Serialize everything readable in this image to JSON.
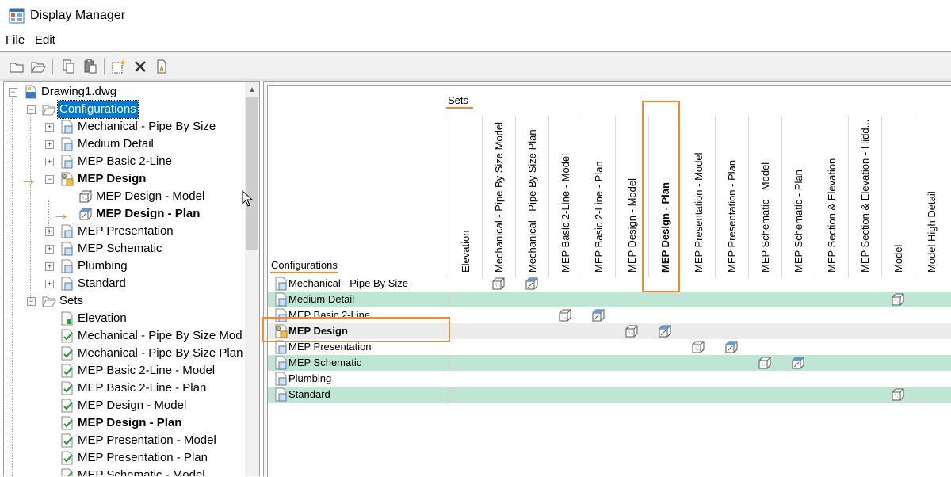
{
  "window": {
    "title": "Display Manager"
  },
  "menu": {
    "items": [
      "File",
      "Edit"
    ]
  },
  "toolbar": {
    "buttons": [
      "new-icon",
      "open-icon",
      "copy-icon",
      "paste-icon",
      "new-set-icon",
      "delete-icon",
      "properties-icon"
    ]
  },
  "tree": {
    "root": "Drawing1.dwg",
    "configurations_label": "Configurations",
    "configurations": [
      "Mechanical - Pipe By Size",
      "Medium Detail",
      "MEP Basic 2-Line",
      "MEP Design",
      "MEP Presentation",
      "MEP Schematic",
      "Plumbing",
      "Standard"
    ],
    "mep_design_children": [
      "MEP Design - Model",
      "MEP Design - Plan"
    ],
    "sets_label": "Sets",
    "sets": [
      "Elevation",
      "Mechanical - Pipe By Size Mod",
      "Mechanical - Pipe By Size Plan",
      "MEP Basic 2-Line - Model",
      "MEP Basic 2-Line - Plan",
      "MEP Design - Model",
      "MEP Design - Plan",
      "MEP Presentation - Model",
      "MEP Presentation - Plan",
      "MEP Schematic - Model"
    ]
  },
  "grid": {
    "sets_header": "Sets",
    "configurations_header": "Configurations",
    "columns": [
      "Elevation",
      "Mechanical - Pipe By Size Model",
      "Mechanical - Pipe By Size Plan",
      "MEP Basic 2-Line - Model",
      "MEP Basic 2-Line - Plan",
      "MEP Design - Model",
      "MEP Design - Plan",
      "MEP Presentation - Model",
      "MEP Presentation - Plan",
      "MEP Schematic - Model",
      "MEP Schematic - Plan",
      "MEP Section & Elevation",
      "MEP Section & Elevation - Hidd...",
      "Model",
      "Model High Detail"
    ],
    "rows": [
      "Mechanical - Pipe By Size",
      "Medium Detail",
      "MEP Basic 2-Line",
      "MEP Design",
      "MEP Presentation",
      "MEP Schematic",
      "Plumbing",
      "Standard"
    ],
    "assignments": [
      {
        "row": 0,
        "col": 1,
        "kind": "model"
      },
      {
        "row": 0,
        "col": 2,
        "kind": "plan"
      },
      {
        "row": 1,
        "col": 13,
        "kind": "model"
      },
      {
        "row": 2,
        "col": 3,
        "kind": "model"
      },
      {
        "row": 2,
        "col": 4,
        "kind": "plan"
      },
      {
        "row": 3,
        "col": 5,
        "kind": "model"
      },
      {
        "row": 3,
        "col": 6,
        "kind": "plan"
      },
      {
        "row": 4,
        "col": 7,
        "kind": "model"
      },
      {
        "row": 4,
        "col": 8,
        "kind": "plan"
      },
      {
        "row": 5,
        "col": 9,
        "kind": "model"
      },
      {
        "row": 5,
        "col": 10,
        "kind": "plan"
      },
      {
        "row": 7,
        "col": 13,
        "kind": "model"
      }
    ]
  },
  "colors": {
    "highlight": "#f28a30",
    "row_alt": "#bfe6d4",
    "selection": "#0078d7"
  }
}
